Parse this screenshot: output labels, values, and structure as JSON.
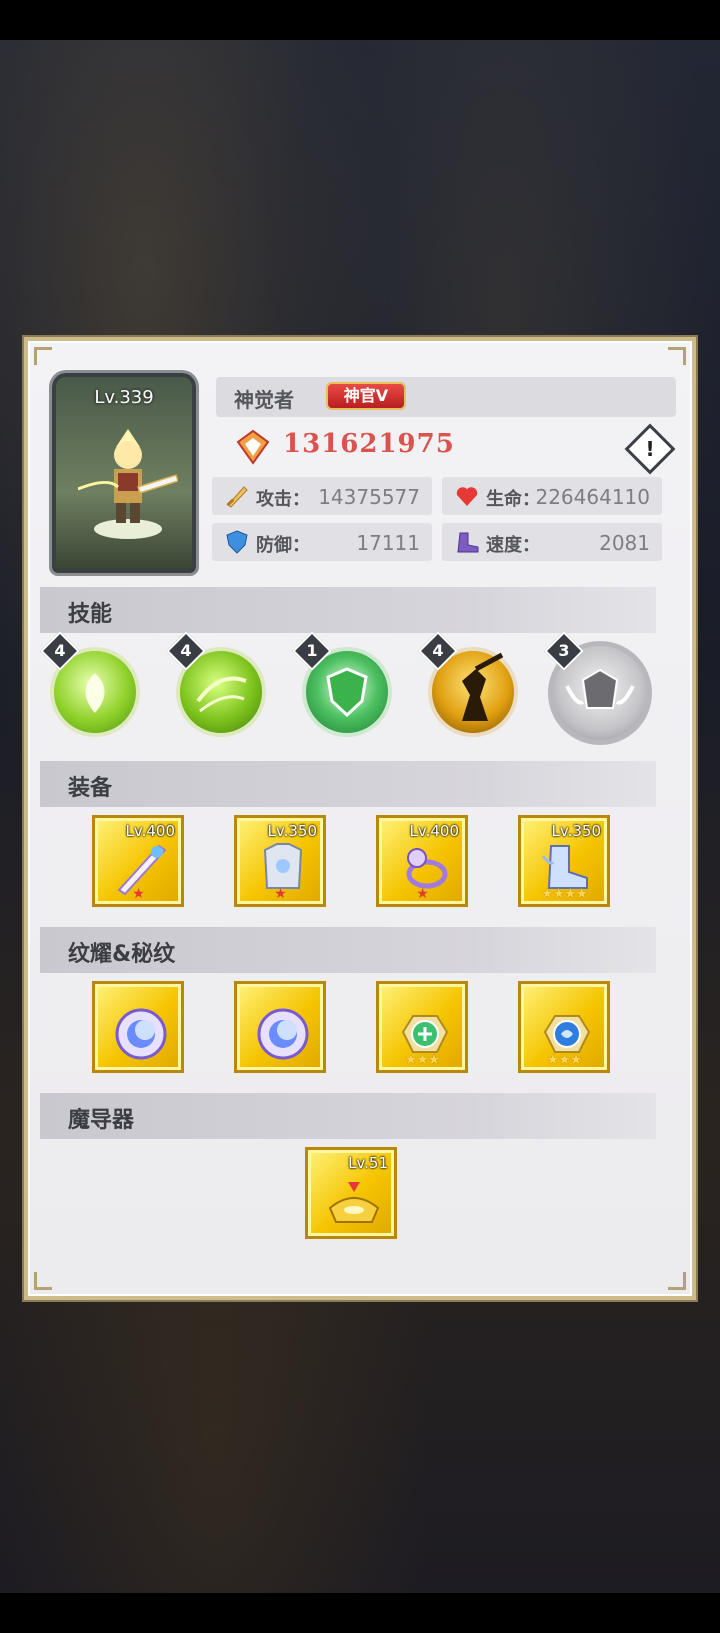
{
  "hero": {
    "level": "Lv.339",
    "name": "神觉者",
    "rank": "神官V",
    "power": "131621975"
  },
  "stats": [
    {
      "label": "攻击：",
      "value": "14375577",
      "icon": "sword-icon"
    },
    {
      "label": "生命：",
      "value": "226464110",
      "icon": "heart-icon"
    },
    {
      "label": "防御：",
      "value": "17111",
      "icon": "shield-icon"
    },
    {
      "label": "速度：",
      "value": "2081",
      "icon": "boot-icon"
    }
  ],
  "sections": {
    "skills": "技能",
    "equipment": "装备",
    "runes": "纹耀&秘纹",
    "artifact": "魔导器"
  },
  "skills": [
    {
      "badge": "4",
      "icon": "leaf-drop-skill-icon"
    },
    {
      "badge": "4",
      "icon": "wind-leaves-skill-icon"
    },
    {
      "badge": "1",
      "icon": "green-shield-skill-icon"
    },
    {
      "badge": "4",
      "icon": "warrior-silhouette-skill-icon"
    },
    {
      "badge": "3",
      "icon": "winged-helmet-skill-icon"
    }
  ],
  "equipment": [
    {
      "level": "Lv.400",
      "stars": "★",
      "star_color": "red",
      "icon": "sword-weapon-icon"
    },
    {
      "level": "Lv.350",
      "stars": "★",
      "star_color": "red",
      "icon": "armor-icon"
    },
    {
      "level": "Lv.400",
      "stars": "★",
      "star_color": "red",
      "icon": "ring-icon"
    },
    {
      "level": "Lv.350",
      "stars": "★★★★",
      "star_color": "gold",
      "icon": "boots-icon"
    }
  ],
  "runes": [
    {
      "stars": "",
      "icon": "moon-sun-emblem-icon"
    },
    {
      "stars": "",
      "icon": "moon-sun-emblem-icon"
    },
    {
      "stars": "★★★",
      "icon": "green-orb-emblem-icon"
    },
    {
      "stars": "★★★",
      "icon": "blue-orb-emblem-icon"
    }
  ],
  "artifact": {
    "level": "Lv.51",
    "icon": "golden-crown-artifact-icon"
  },
  "colors": {
    "power": "#d9534f",
    "panel_border": "#cdbb8a",
    "item_gold": "#f5c400"
  }
}
